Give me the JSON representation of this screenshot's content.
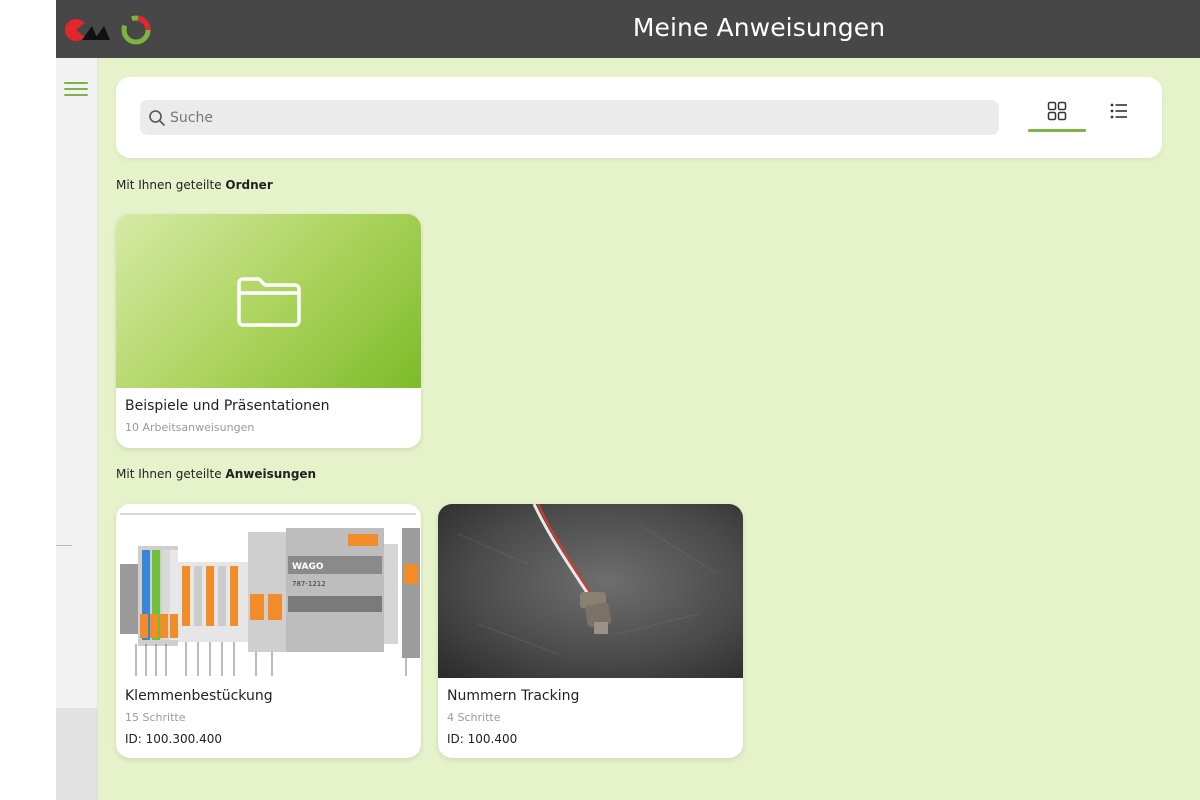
{
  "header": {
    "title": "Meine Anweisungen",
    "brand_colors": {
      "red": "#e3262b",
      "black": "#111111",
      "green": "#7cb342"
    }
  },
  "search": {
    "placeholder": "Suche",
    "value": ""
  },
  "view_toggle": {
    "active": "grid",
    "grid_icon": "grid-icon",
    "list_icon": "list-icon",
    "accent": "#7cb342"
  },
  "sections": {
    "folders_prefix": "Mit Ihnen geteilte ",
    "folders_strong": "Ordner",
    "instructions_prefix": "Mit Ihnen geteilte ",
    "instructions_strong": "Anweisungen"
  },
  "folders": [
    {
      "title": "Beispiele und Präsentationen",
      "subtitle": "10 Arbeitsanweisungen",
      "icon": "folder-icon"
    }
  ],
  "instructions": [
    {
      "title": "Klemmenbestückung",
      "subtitle": "15 Schritte",
      "id_text": "ID: 100.300.400",
      "thumb_text": "787-1212"
    },
    {
      "title": "Nummern Tracking",
      "subtitle": "4 Schritte",
      "id_text": "ID: 100.400"
    }
  ],
  "colors": {
    "background": "#e6f2c9",
    "topbar": "#474747",
    "accent": "#7cb342"
  }
}
